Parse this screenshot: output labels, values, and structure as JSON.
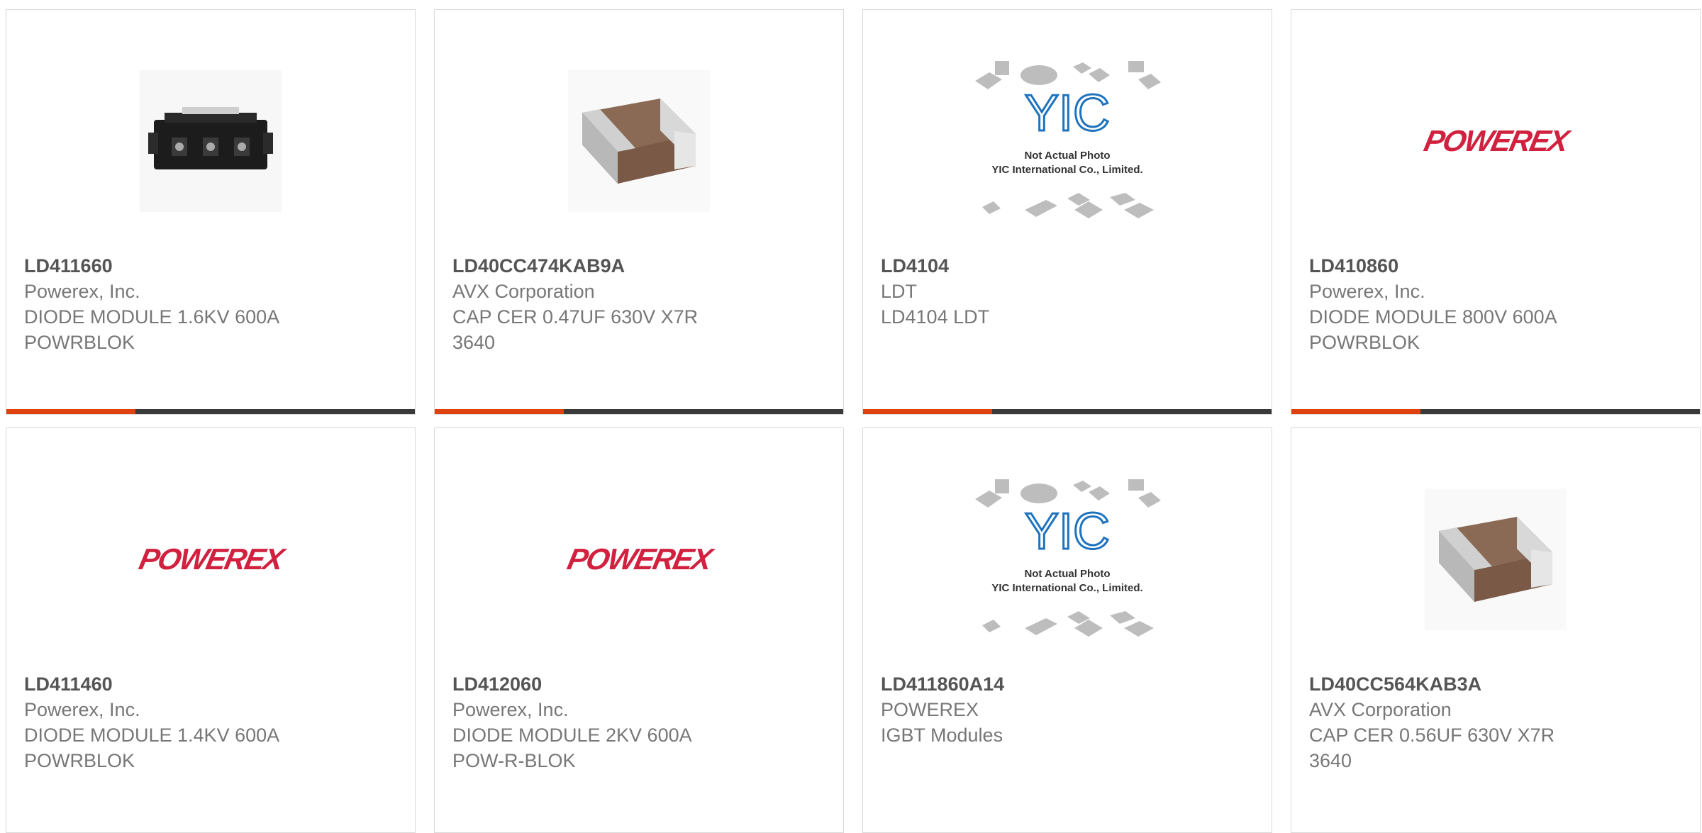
{
  "products": [
    {
      "part_number": "LD411660",
      "manufacturer": "Powerex, Inc.",
      "desc1": "DIODE MODULE 1.6KV 600A",
      "desc2": "POWRBLOK",
      "image": "diode-module-photo"
    },
    {
      "part_number": "LD40CC474KAB9A",
      "manufacturer": "AVX Corporation",
      "desc1": "CAP CER 0.47UF 630V X7R",
      "desc2": "3640",
      "image": "ceramic-capacitor-photo"
    },
    {
      "part_number": "LD4104",
      "manufacturer": "LDT",
      "desc1": "LD4104 LDT",
      "desc2": "",
      "image": "yic-placeholder",
      "placeholder_line1": "Not Actual Photo",
      "placeholder_line2": "YIC International Co., Limited.",
      "placeholder_logo": "YIC"
    },
    {
      "part_number": "LD410860",
      "manufacturer": "Powerex, Inc.",
      "desc1": "DIODE MODULE 800V 600A",
      "desc2": "POWRBLOK",
      "image": "powerex-logo",
      "logo_text": "POWEREX"
    },
    {
      "part_number": "LD411460",
      "manufacturer": "Powerex, Inc.",
      "desc1": "DIODE MODULE 1.4KV 600A",
      "desc2": "POWRBLOK",
      "image": "powerex-logo",
      "logo_text": "POWEREX"
    },
    {
      "part_number": "LD412060",
      "manufacturer": "Powerex, Inc.",
      "desc1": "DIODE MODULE 2KV 600A",
      "desc2": "POW-R-BLOK",
      "image": "powerex-logo",
      "logo_text": "POWEREX"
    },
    {
      "part_number": "LD411860A14",
      "manufacturer": "POWEREX",
      "desc1": "IGBT Modules",
      "desc2": "",
      "image": "yic-placeholder",
      "placeholder_line1": "Not Actual Photo",
      "placeholder_line2": "YIC International Co., Limited.",
      "placeholder_logo": "YIC"
    },
    {
      "part_number": "LD40CC564KAB3A",
      "manufacturer": "AVX Corporation",
      "desc1": "CAP CER 0.56UF 630V X7R",
      "desc2": "3640",
      "image": "ceramic-capacitor-photo"
    }
  ],
  "colors": {
    "accent": "#e0420f",
    "bar": "#3a3a3a",
    "powerex_red": "#d1213f",
    "yic_blue": "#1e73be"
  }
}
